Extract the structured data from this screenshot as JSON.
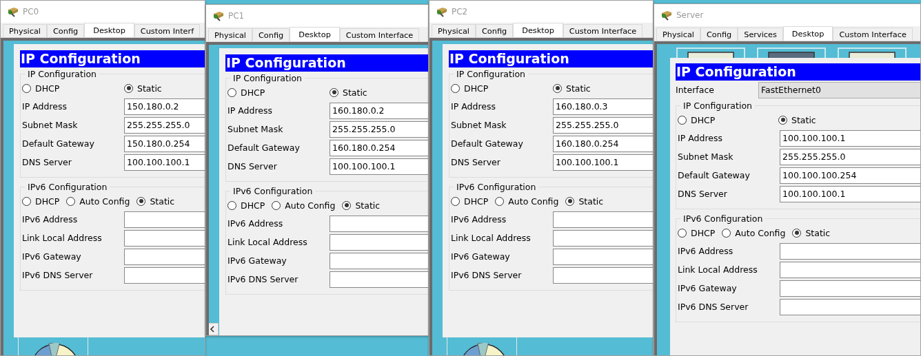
{
  "windows": [
    {
      "kind": "pc",
      "title": "PC0",
      "tabs": [
        {
          "label": "Physical",
          "selected": false
        },
        {
          "label": "Config",
          "selected": false
        },
        {
          "label": "Desktop",
          "selected": true
        },
        {
          "label": "Custom Interf",
          "selected": false
        }
      ],
      "ip_config": {
        "header": "IP Configuration",
        "ipv4_title": "IP Configuration",
        "ipv4_modes": [
          {
            "label": "DHCP",
            "selected": false
          },
          {
            "label": "Static",
            "selected": true
          }
        ],
        "ipv4_fields": [
          {
            "label": "IP Address",
            "value": "150.180.0.2"
          },
          {
            "label": "Subnet Mask",
            "value": "255.255.255.0"
          },
          {
            "label": "Default Gateway",
            "value": "150.180.0.254"
          },
          {
            "label": "DNS Server",
            "value": "100.100.100.1"
          }
        ],
        "ipv6_title": "IPv6 Configuration",
        "ipv6_modes": [
          {
            "label": "DHCP",
            "selected": false
          },
          {
            "label": "Auto Config",
            "selected": false
          },
          {
            "label": "Static",
            "selected": true
          }
        ],
        "ipv6_fields": [
          {
            "label": "IPv6 Address"
          },
          {
            "label": "Link Local Address"
          },
          {
            "label": "IPv6 Gateway"
          },
          {
            "label": "IPv6 DNS Server"
          }
        ]
      }
    },
    {
      "kind": "pc",
      "title": "PC1",
      "tabs": [
        {
          "label": "Physical",
          "selected": false
        },
        {
          "label": "Config",
          "selected": false
        },
        {
          "label": "Desktop",
          "selected": true
        },
        {
          "label": "Custom Interface",
          "selected": false
        }
      ],
      "ip_config": {
        "header": "IP Configuration",
        "ipv4_title": "IP Configuration",
        "ipv4_modes": [
          {
            "label": "DHCP",
            "selected": false
          },
          {
            "label": "Static",
            "selected": true
          }
        ],
        "ipv4_fields": [
          {
            "label": "IP Address",
            "value": "160.180.0.2"
          },
          {
            "label": "Subnet Mask",
            "value": "255.255.255.0"
          },
          {
            "label": "Default Gateway",
            "value": "160.180.0.254"
          },
          {
            "label": "DNS Server",
            "value": "100.100.100.1"
          }
        ],
        "ipv6_title": "IPv6 Configuration",
        "ipv6_modes": [
          {
            "label": "DHCP",
            "selected": false
          },
          {
            "label": "Auto Config",
            "selected": false
          },
          {
            "label": "Static",
            "selected": true
          }
        ],
        "ipv6_fields": [
          {
            "label": "IPv6 Address"
          },
          {
            "label": "Link Local Address"
          },
          {
            "label": "IPv6 Gateway"
          },
          {
            "label": "IPv6 DNS Server"
          }
        ]
      }
    },
    {
      "kind": "pc",
      "title": "PC2",
      "tabs": [
        {
          "label": "Physical",
          "selected": false
        },
        {
          "label": "Config",
          "selected": false
        },
        {
          "label": "Desktop",
          "selected": true
        },
        {
          "label": "Custom Interface",
          "selected": false
        }
      ],
      "ip_config": {
        "header": "IP Configuration",
        "ipv4_title": "IP Configuration",
        "ipv4_modes": [
          {
            "label": "DHCP",
            "selected": false
          },
          {
            "label": "Static",
            "selected": true
          }
        ],
        "ipv4_fields": [
          {
            "label": "IP Address",
            "value": "160.180.0.3"
          },
          {
            "label": "Subnet Mask",
            "value": "255.255.255.0"
          },
          {
            "label": "Default Gateway",
            "value": "160.180.0.254"
          },
          {
            "label": "DNS Server",
            "value": "100.100.100.1"
          }
        ],
        "ipv6_title": "IPv6 Configuration",
        "ipv6_modes": [
          {
            "label": "DHCP",
            "selected": false
          },
          {
            "label": "Auto Config",
            "selected": false
          },
          {
            "label": "Static",
            "selected": true
          }
        ],
        "ipv6_fields": [
          {
            "label": "IPv6 Address"
          },
          {
            "label": "Link Local Address"
          },
          {
            "label": "IPv6 Gateway"
          },
          {
            "label": "IPv6 DNS Server"
          }
        ]
      }
    },
    {
      "kind": "server",
      "title": "Server",
      "tabs": [
        {
          "label": "Physical",
          "selected": false
        },
        {
          "label": "Config",
          "selected": false
        },
        {
          "label": "Services",
          "selected": false
        },
        {
          "label": "Desktop",
          "selected": true
        },
        {
          "label": "Custom Interface",
          "selected": false
        }
      ],
      "ip_config": {
        "header": "IP Configuration",
        "interface_label": "Interface",
        "interface_value": "FastEthernet0",
        "ipv4_title": "IP Configuration",
        "ipv4_modes": [
          {
            "label": "DHCP",
            "selected": false
          },
          {
            "label": "Static",
            "selected": true
          }
        ],
        "ipv4_fields": [
          {
            "label": "IP Address",
            "value": "100.100.100.1"
          },
          {
            "label": "Subnet Mask",
            "value": "255.255.255.0"
          },
          {
            "label": "Default Gateway",
            "value": "100.100.100.254"
          },
          {
            "label": "DNS Server",
            "value": "100.100.100.1"
          }
        ],
        "ipv6_title": "IPv6 Configuration",
        "ipv6_modes": [
          {
            "label": "DHCP",
            "selected": false
          },
          {
            "label": "Auto Config",
            "selected": false
          },
          {
            "label": "Static",
            "selected": true
          }
        ],
        "ipv6_fields": [
          {
            "label": "IPv6 Address"
          },
          {
            "label": "Link Local Address"
          },
          {
            "label": "IPv6 Gateway"
          },
          {
            "label": "IPv6 DNS Server"
          }
        ]
      }
    }
  ]
}
